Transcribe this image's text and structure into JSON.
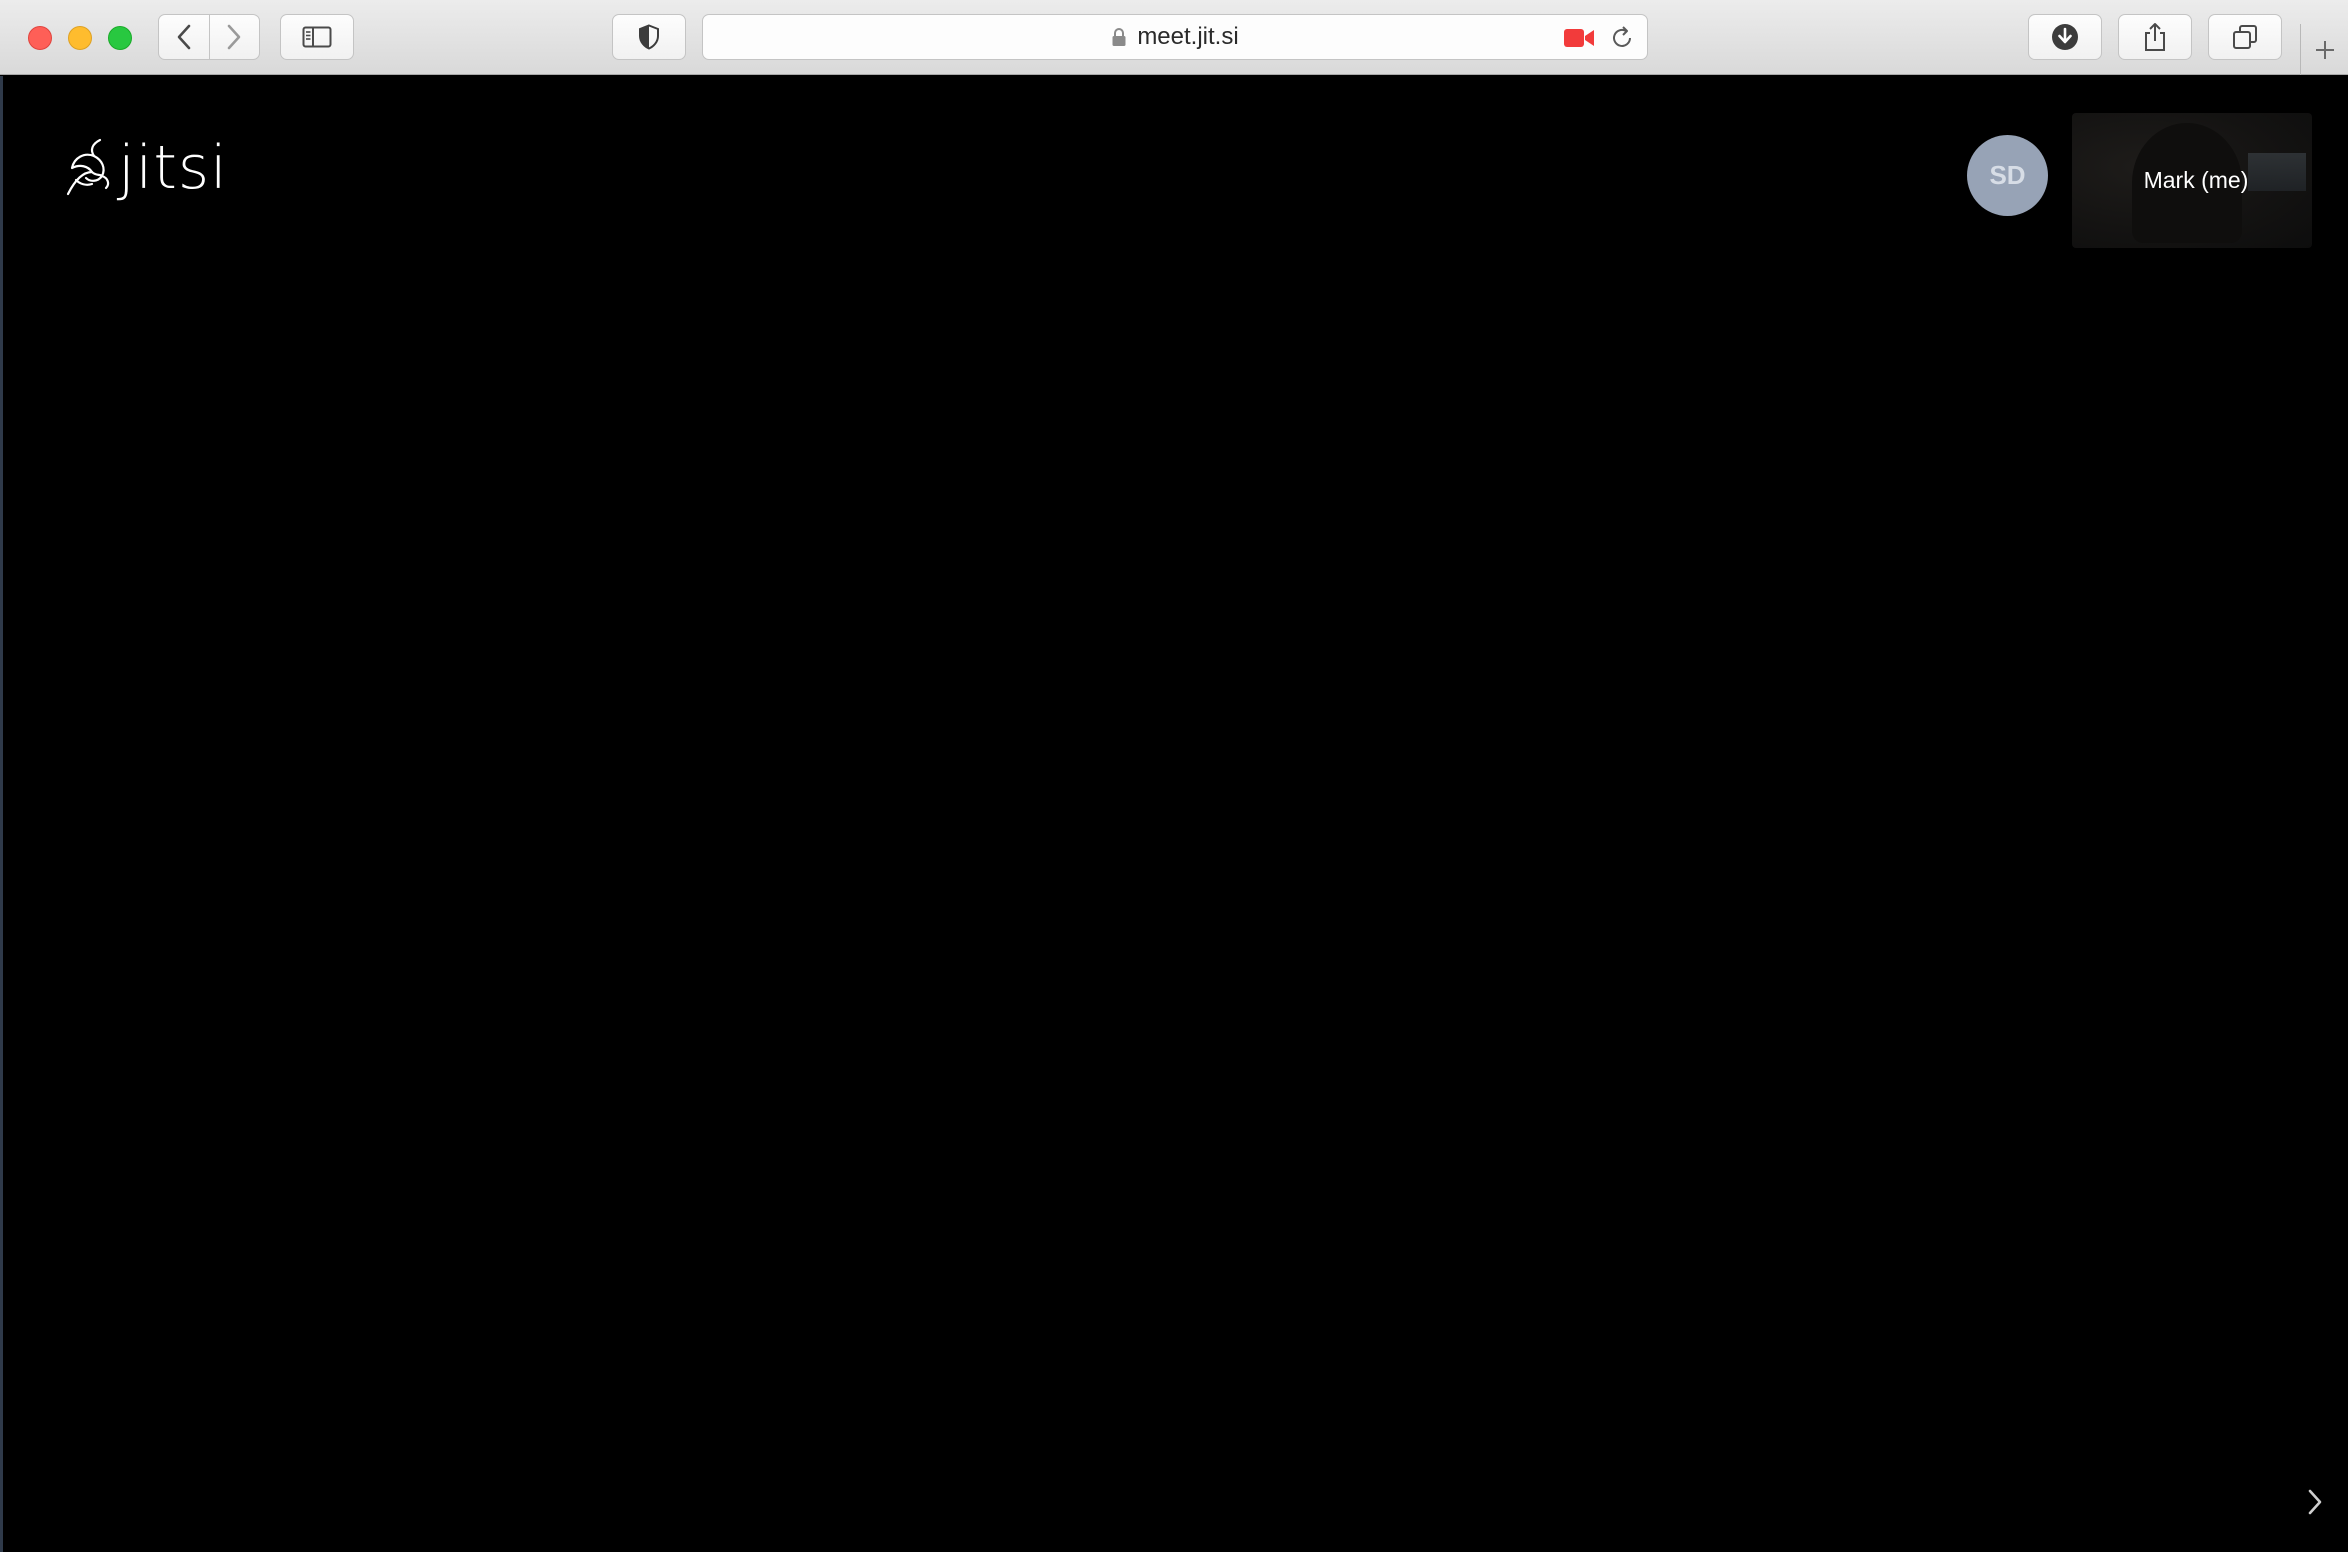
{
  "browser": {
    "url": "meet.jit.si",
    "buttons": {
      "close": "close-window",
      "minimize": "minimize-window",
      "maximize": "maximize-window",
      "back": "chevron-left-icon",
      "forward": "chevron-right-icon",
      "sidebar": "sidebar-icon",
      "privacy": "shield-icon",
      "camera_in_use": "video-camera-icon",
      "reload": "reload-icon",
      "downloads": "download-icon",
      "share": "share-icon",
      "tabs": "tabs-overview-icon",
      "new_tab": "plus-icon"
    },
    "colors": {
      "close": "#fe5f57",
      "minimize": "#febc2e",
      "maximize": "#28c840",
      "camera_indicator": "#f23b3b"
    }
  },
  "meeting": {
    "logo_text": "jitsi",
    "participants": [
      {
        "initials": "SD",
        "avatar_color": "#97a3b6"
      }
    ],
    "self_view": {
      "name": "Mark (me)"
    },
    "background": "#000000"
  }
}
